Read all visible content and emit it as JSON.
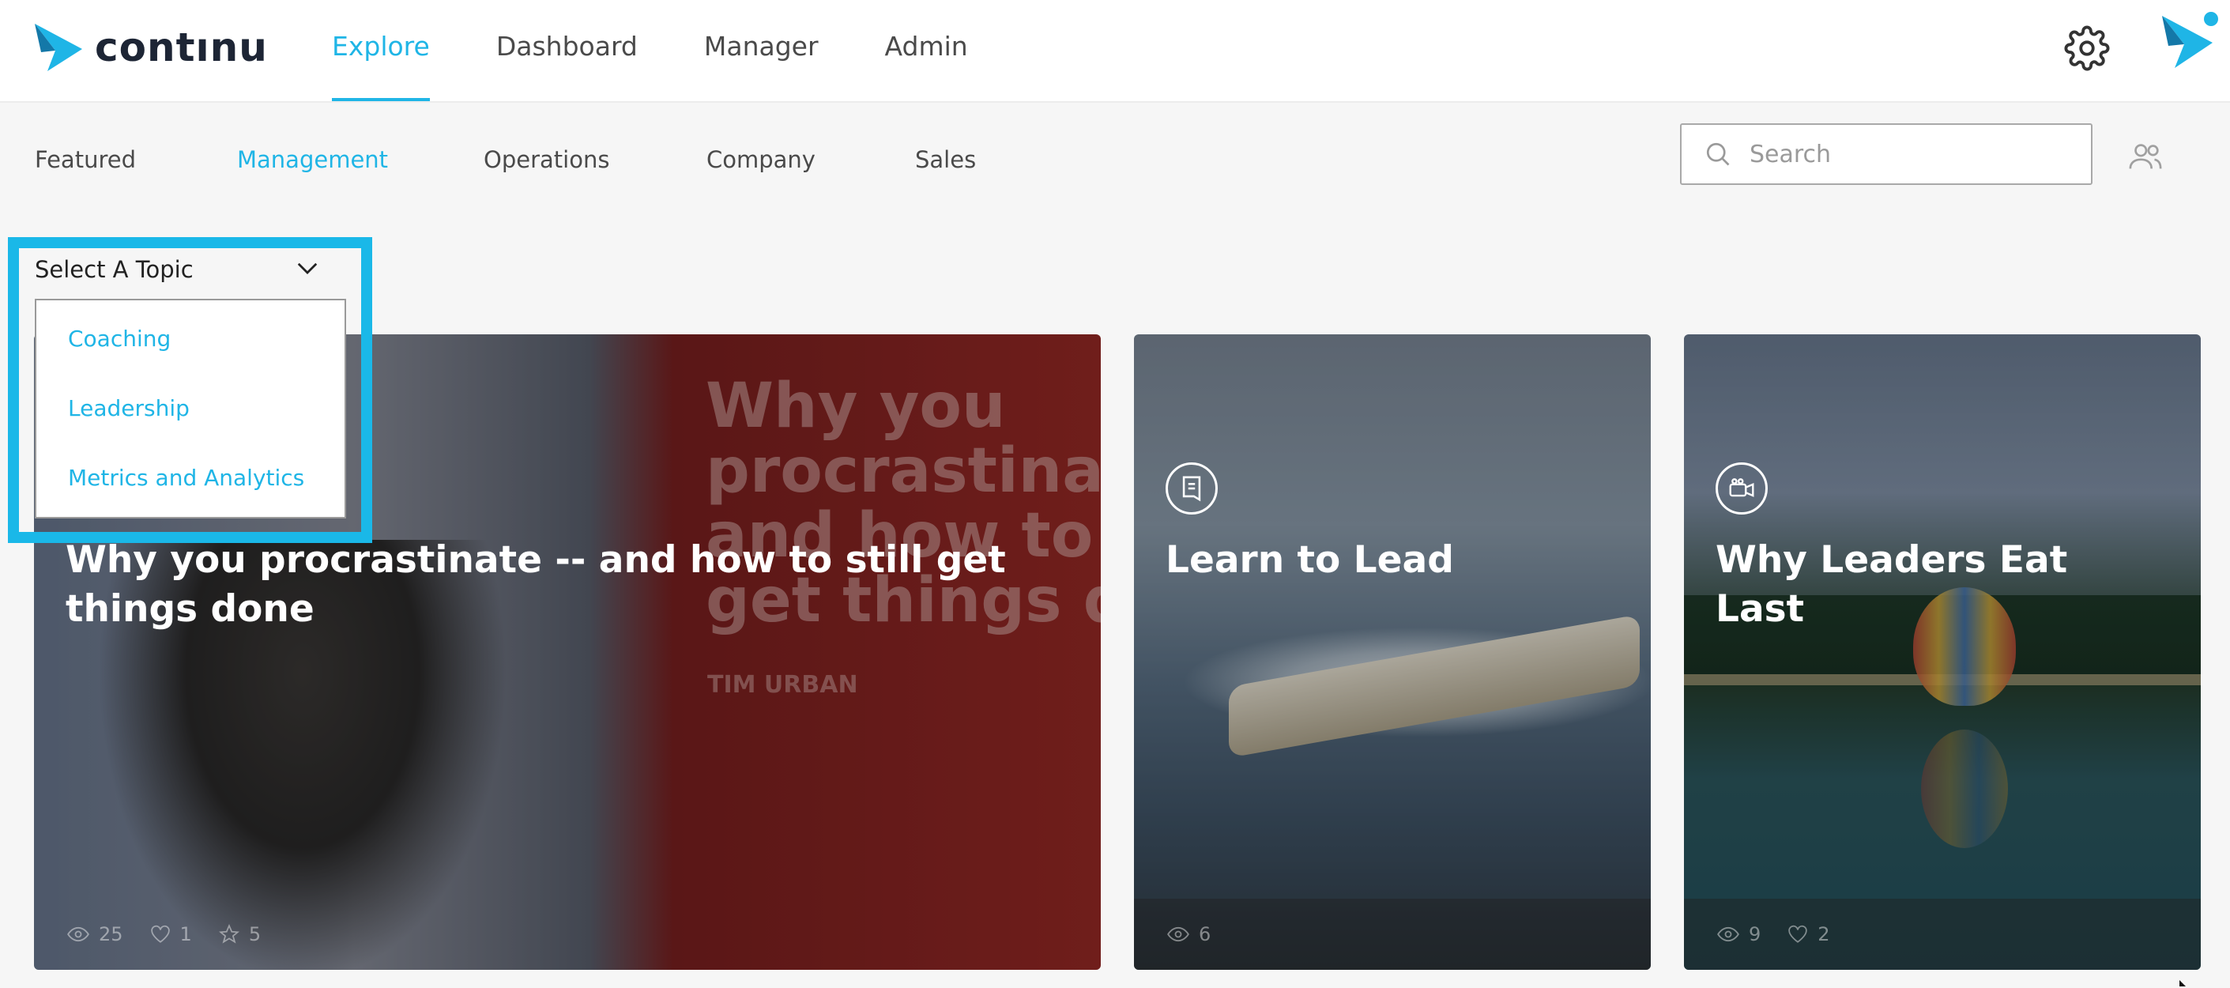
{
  "app": {
    "brand": "contınu"
  },
  "nav": {
    "items": [
      "Explore",
      "Dashboard",
      "Manager",
      "Admin"
    ],
    "active": "Explore"
  },
  "subtabs": {
    "items": [
      "Featured",
      "Management",
      "Operations",
      "Company",
      "Sales"
    ],
    "active": "Management"
  },
  "search": {
    "placeholder": "Search",
    "value": ""
  },
  "topic_select": {
    "label": "Select A Topic",
    "options": [
      "Coaching",
      "Leadership",
      "Metrics and Analytics"
    ]
  },
  "cards": [
    {
      "title": "Why you procrastinate -- and how to still get things done",
      "slide_text": "Why you\nprocrastinat\nand how to s\nget things do",
      "slide_name": "TIM URBAN",
      "stats": {
        "views": "25",
        "likes": "1",
        "stars": "5"
      }
    },
    {
      "title": "Learn to Lead",
      "type_icon": "document-icon",
      "stats": {
        "views": "6"
      }
    },
    {
      "title": "Why Leaders Eat Last",
      "type_icon": "video-icon",
      "stats": {
        "views": "9",
        "likes": "2"
      }
    }
  ],
  "colors": {
    "accent": "#1fb5e6",
    "highlight": "#1ab8e8",
    "brand_dark": "#1d2535"
  }
}
